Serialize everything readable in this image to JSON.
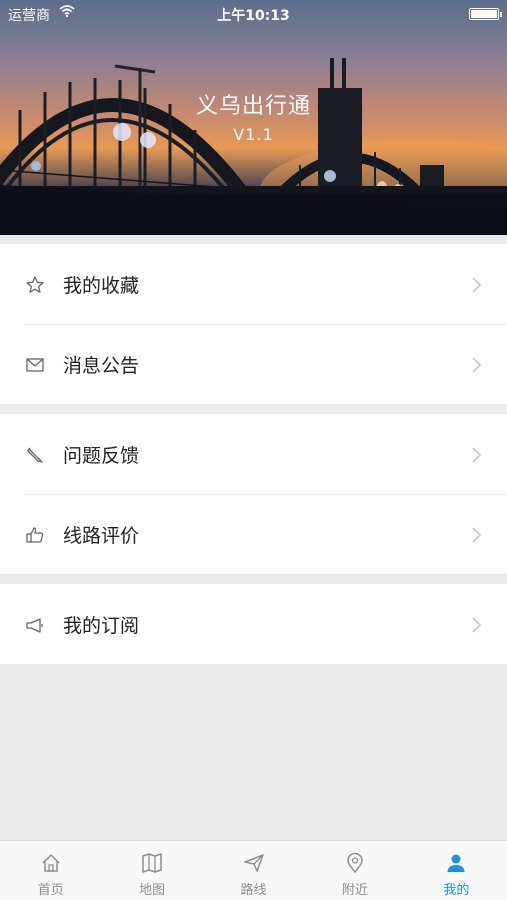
{
  "status_bar": {
    "carrier": "运营商",
    "time": "上午10:13"
  },
  "header": {
    "title": "义乌出行通",
    "version": "V1.1"
  },
  "menu_groups": [
    {
      "items": [
        {
          "label": "我的收藏",
          "icon": "star-icon"
        },
        {
          "label": "消息公告",
          "icon": "mail-icon"
        }
      ]
    },
    {
      "items": [
        {
          "label": "问题反馈",
          "icon": "pencil-icon"
        },
        {
          "label": "线路评价",
          "icon": "thumbs-up-icon"
        }
      ]
    },
    {
      "items": [
        {
          "label": "我的订阅",
          "icon": "megaphone-icon"
        }
      ]
    }
  ],
  "tabs": [
    {
      "label": "首页",
      "icon": "home-icon",
      "active": false
    },
    {
      "label": "地图",
      "icon": "map-icon",
      "active": false
    },
    {
      "label": "路线",
      "icon": "paper-plane-icon",
      "active": false
    },
    {
      "label": "附近",
      "icon": "location-pin-icon",
      "active": false
    },
    {
      "label": "我的",
      "icon": "person-icon",
      "active": true
    }
  ],
  "colors": {
    "accent": "#1e90e8",
    "tab_inactive": "#8e8e8e",
    "background": "#ebebeb"
  }
}
